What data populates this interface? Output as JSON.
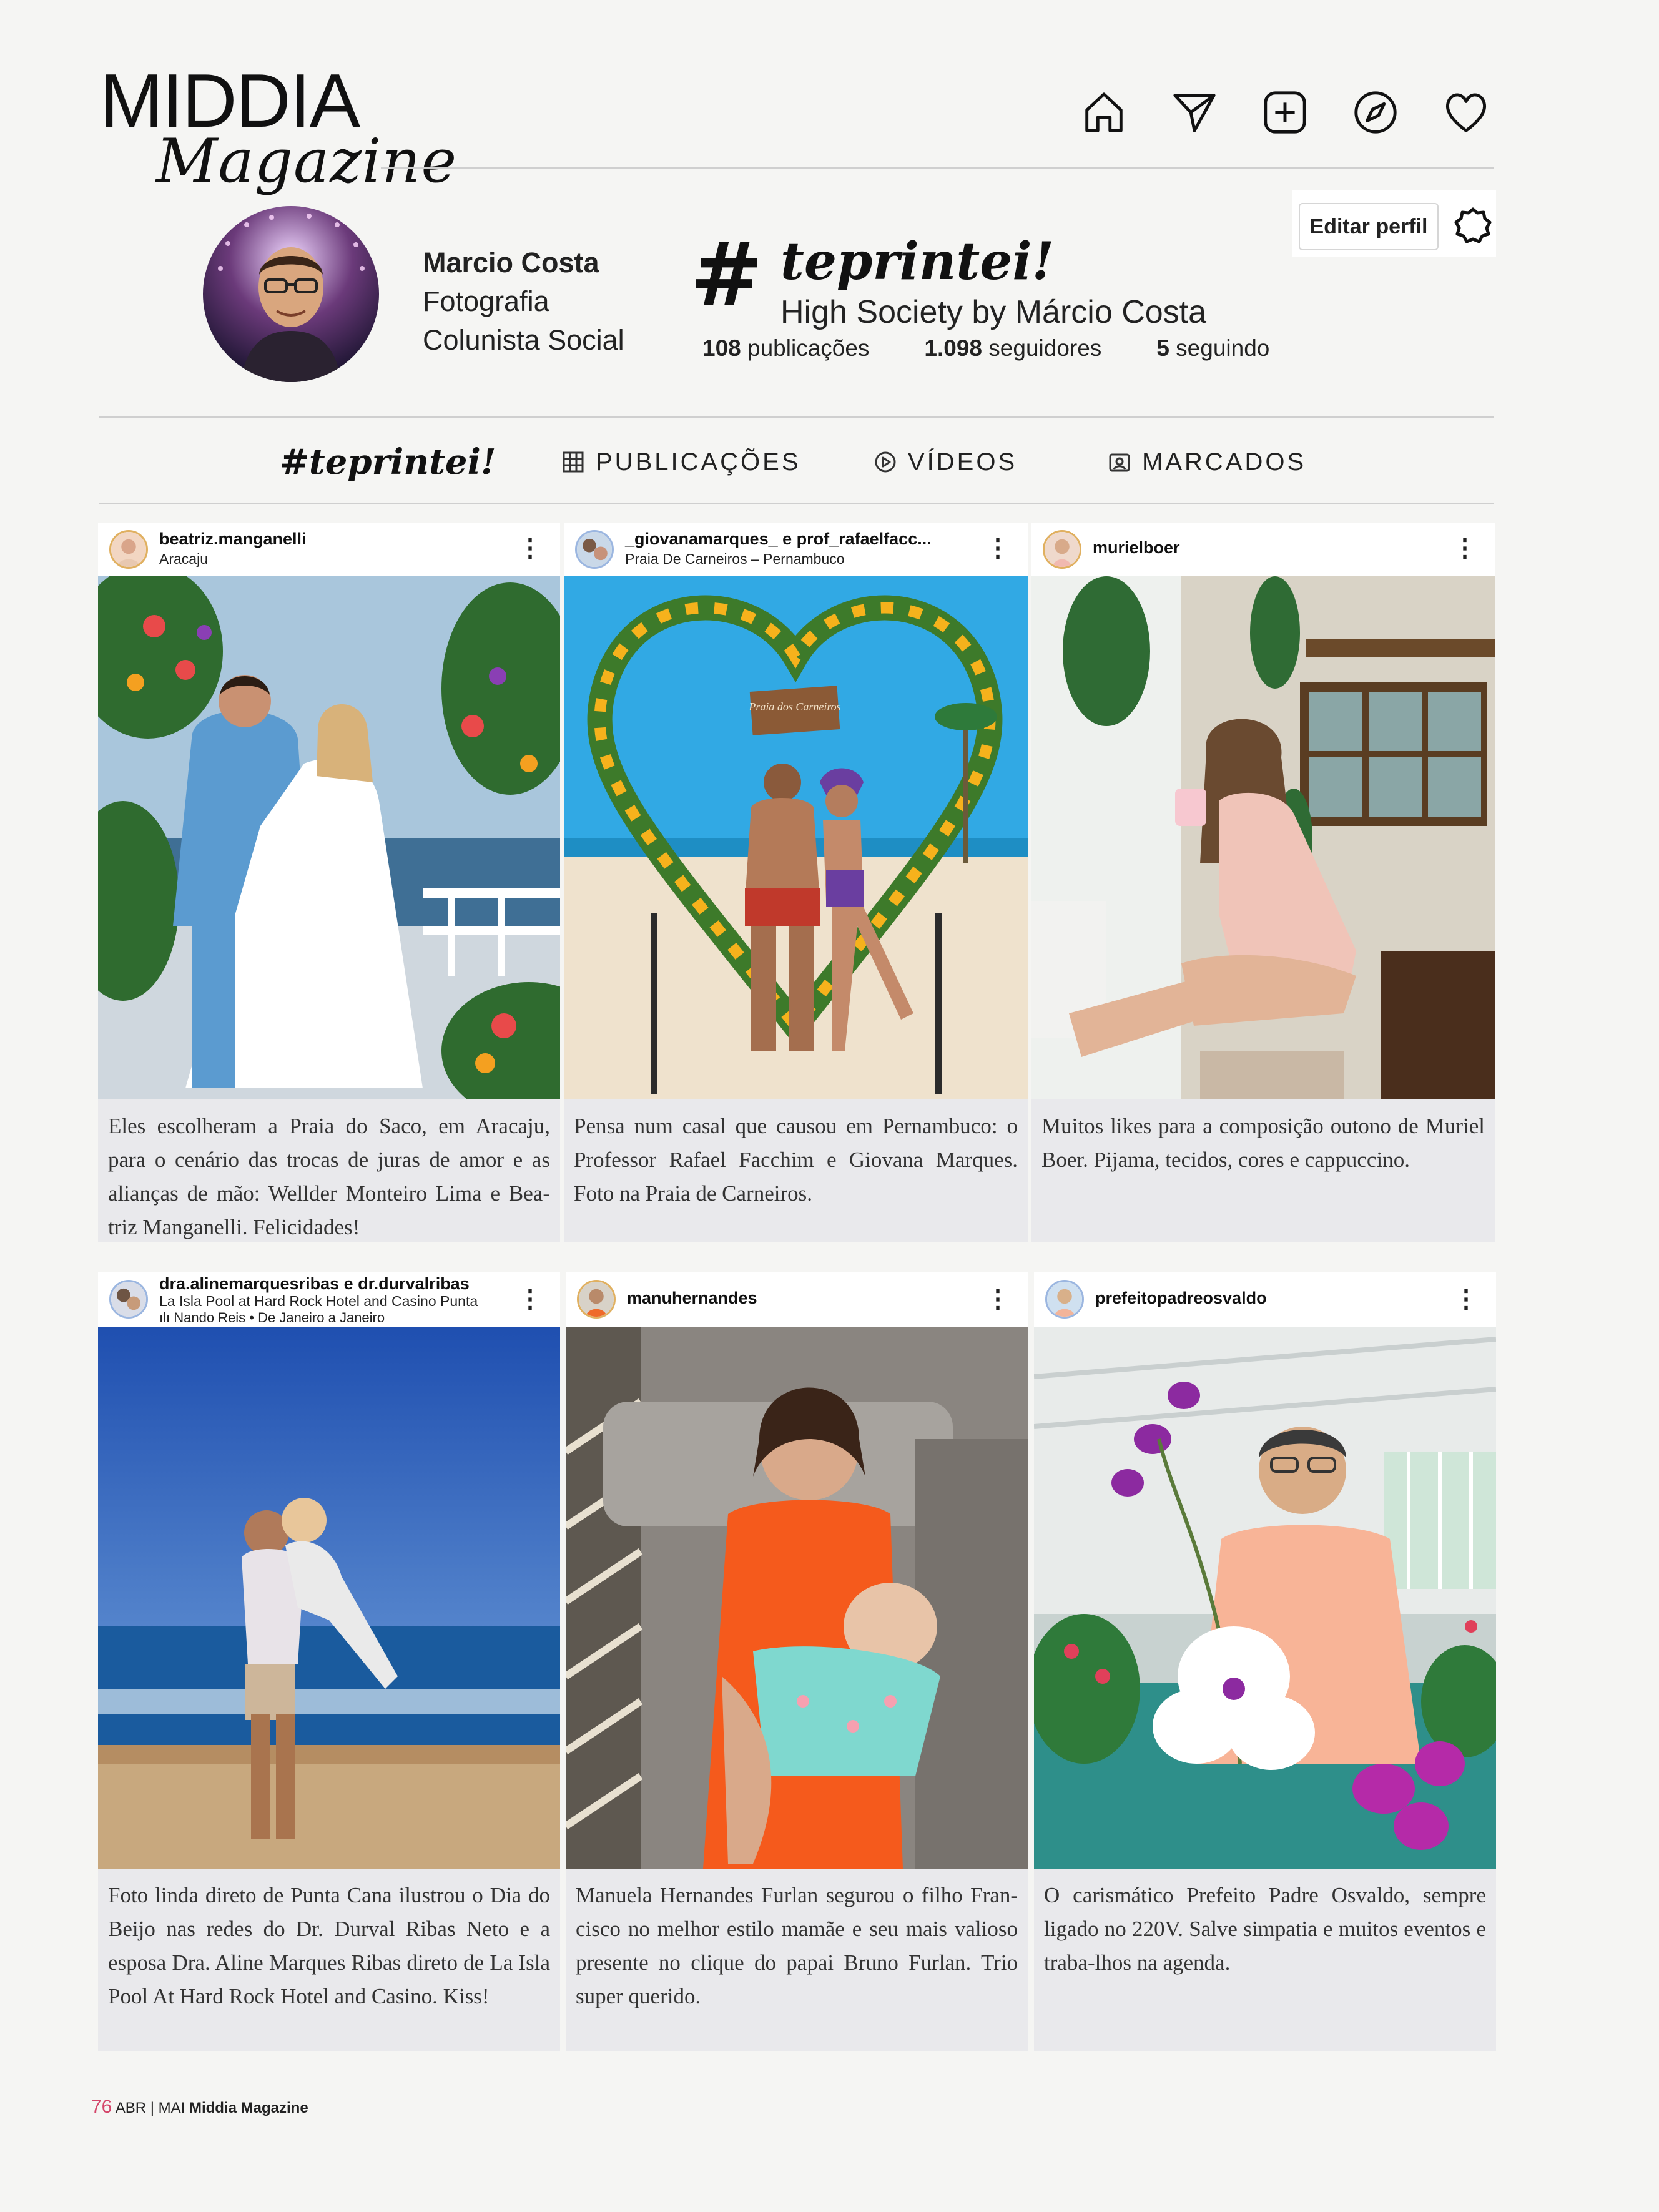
{
  "header": {
    "logo_word": "MIDDIA",
    "logo_script": "Magazine",
    "nav": [
      "home-icon",
      "send-icon",
      "add-post-icon",
      "explore-icon",
      "heart-icon"
    ]
  },
  "profile": {
    "name": "Marcio Costa",
    "role_1": "Fotografia",
    "role_2": "Colunista Social",
    "hash_symbol": "#",
    "brand": "teprintei!",
    "subtitle": "High Society by Márcio Costa",
    "stats": {
      "posts_num": "108",
      "posts_label": "publicações",
      "followers_num": "1.098",
      "followers_label": "seguidores",
      "following_num": "5",
      "following_label": "seguindo"
    },
    "edit_button": "Editar perfil"
  },
  "tabs": {
    "brand": "#teprintei!",
    "posts": "PUBLICAÇÕES",
    "videos": "VÍDEOS",
    "tagged": "MARCADOS"
  },
  "posts": [
    {
      "user": "beatriz.manganelli",
      "location": "Aracaju",
      "caption": "Eles escolheram a Praia do Saco, em Aracaju, para o cenário das trocas de juras de amor e as alianças de mão: Wellder Monteiro Lima e Bea-triz Manganelli. Felicidades!"
    },
    {
      "user": "_giovanamarques_ e prof_rafaelfacc...",
      "location": "Praia De Carneiros – Pernambuco",
      "sign_text": "Praia dos Carneiros",
      "caption": "Pensa num casal que causou em Pernambuco: o Professor Rafael Facchim e Giovana Marques. Foto na Praia de Carneiros."
    },
    {
      "user": "murielboer",
      "caption": "Muitos likes para a composição outono de Muriel Boer. Pijama, tecidos, cores e cappuccino."
    },
    {
      "user": "dra.alinemarquesribas e dr.durvalribas",
      "location": "La Isla Pool at Hard Rock Hotel and Casino Punta",
      "music": "Nando Reis • De Janeiro a Janeiro",
      "caption": "Foto linda direto de Punta Cana ilustrou o Dia do Beijo nas redes do Dr. Durval Ribas Neto e a esposa Dra. Aline Marques Ribas direto de La Isla Pool At Hard Rock Hotel and Casino. Kiss!"
    },
    {
      "user": "manuhernandes",
      "caption": "Manuela Hernandes Furlan segurou o filho Fran-cisco no melhor estilo mamãe e seu mais valioso presente no clique do papai Bruno Furlan. Trio super querido."
    },
    {
      "user": "prefeitopadreosvaldo",
      "caption": "O carismático Prefeito Padre Osvaldo, sempre ligado no 220V. Salve simpatia e muitos eventos e traba-lhos na agenda."
    }
  ],
  "more_glyph": "⋮",
  "footer": {
    "page": "76",
    "issue": "ABR | MAI",
    "magazine": "Middia Magazine"
  }
}
